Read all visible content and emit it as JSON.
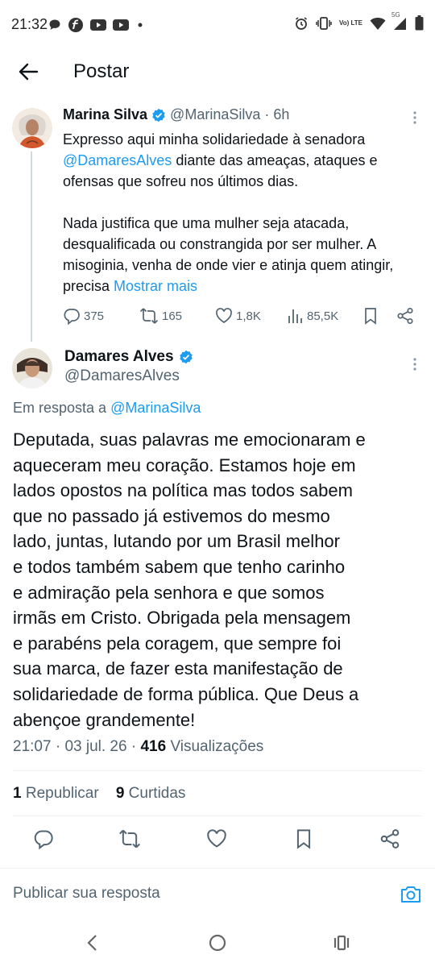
{
  "status_bar": {
    "time": "21:32",
    "left_icons": [
      "chat-bubble-icon",
      "app-f-icon",
      "youtube-icon",
      "youtube-icon",
      "dot-icon"
    ],
    "network_label": "Vo) LTE",
    "signal_5g": "5G",
    "right_icons": [
      "alarm-icon",
      "vibrate-icon",
      "volte-icon",
      "wifi-icon",
      "signal-icon",
      "battery-icon"
    ]
  },
  "header": {
    "title": "Postar",
    "back_icon": "arrow-left-icon"
  },
  "tweet1": {
    "author_name": "Marina Silva",
    "verified_icon": "verified-badge-icon",
    "handle": "@MarinaSilva",
    "separator": "·",
    "time": "6h",
    "text_part1": "Expresso aqui minha solidariedade à senadora ",
    "mention": "@DamaresAlves",
    "text_part2": " diante das ameaças, ataques e ofensas que sofreu nos últimos dias.",
    "text_para2": "Nada justifica que uma mulher seja atacada, desqualificada ou constrangida por ser mulher. A misoginia, venha de onde vier e atinja quem atingir, precisa ",
    "show_more": "Mostrar mais",
    "replies": "375",
    "reposts": "165",
    "likes": "1,8K",
    "views": "85,5K"
  },
  "tweet2": {
    "author_name": "Damares Alves",
    "verified_icon": "verified-badge-icon",
    "handle": "@DamaresAlves",
    "reply_prefix": "Em resposta a ",
    "reply_to": "@MarinaSilva",
    "text": "Deputada, suas palavras me emocionaram e\naqueceram meu coração.  Estamos hoje em\nlados opostos na política mas todos sabem\nque  no passado já estivemos do mesmo\nlado, juntas, lutando por um Brasil melhor\ne todos também sabem que tenho carinho\ne admiração pela senhora e que somos\nirmãs em Cristo. Obrigada pela mensagem\ne parabéns pela coragem,  que sempre foi\nsua marca, de fazer esta manifestação de\nsolidariedade de forma pública. Que Deus a\nabençoe grandemente!",
    "time": "21:07",
    "date": "03 jul. 26",
    "views_count": "416",
    "views_label": "Visualizações",
    "reposts_count": "1",
    "reposts_label": "Republicar",
    "likes_count": "9",
    "likes_label": "Curtidas"
  },
  "reply_box": {
    "placeholder": "Publicar sua resposta",
    "camera_icon": "camera-icon"
  },
  "nav": {
    "icons": [
      "back-chevron-icon",
      "home-circle-icon",
      "recents-icon"
    ]
  },
  "colors": {
    "link": "#1d9bf0",
    "muted": "#536471",
    "text": "#0f1419",
    "divider": "#eff3f4"
  }
}
